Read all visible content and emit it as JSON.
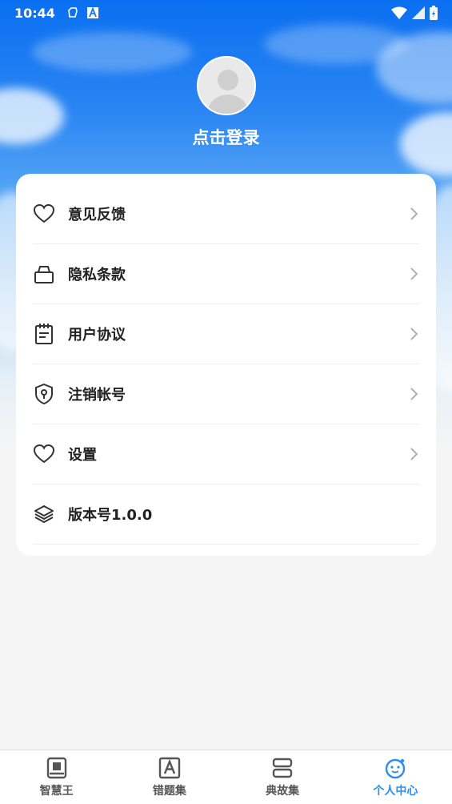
{
  "status_bar": {
    "time": "10:44"
  },
  "profile": {
    "login_text": "点击登录"
  },
  "menu": {
    "items": [
      {
        "label": "意见反馈",
        "icon": "heart-icon",
        "has_arrow": true
      },
      {
        "label": "隐私条款",
        "icon": "lock-icon",
        "has_arrow": true
      },
      {
        "label": "用户协议",
        "icon": "clipboard-icon",
        "has_arrow": true
      },
      {
        "label": "注销帐号",
        "icon": "shield-key-icon",
        "has_arrow": true
      },
      {
        "label": "设置",
        "icon": "heart-icon",
        "has_arrow": true
      },
      {
        "label": "版本号1.0.0",
        "icon": "layers-icon",
        "has_arrow": false
      }
    ]
  },
  "tabbar": {
    "tabs": [
      {
        "label": "智慧王",
        "icon": "book-icon",
        "active": false
      },
      {
        "label": "错题集",
        "icon": "letter-a-icon",
        "active": false
      },
      {
        "label": "典故集",
        "icon": "stack-icon",
        "active": false
      },
      {
        "label": "个人中心",
        "icon": "smiley-icon",
        "active": true
      }
    ],
    "active_color": "#2b8ef0",
    "inactive_color": "#555555"
  }
}
